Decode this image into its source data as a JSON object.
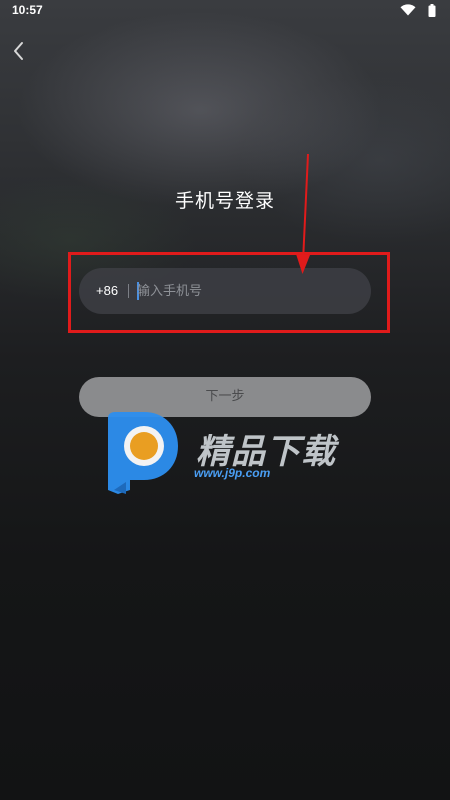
{
  "status_bar": {
    "time": "10:57",
    "icons": [
      "wifi-icon",
      "battery-icon"
    ]
  },
  "header": {
    "back_icon": "chevron-left-icon",
    "title": "手机号登录"
  },
  "phone_form": {
    "country_code": "+86",
    "phone_value": "",
    "phone_placeholder": "输入手机号"
  },
  "next_button": {
    "label": "下一步"
  },
  "watermark": {
    "logo_icon": "p-logo-icon",
    "text": "精品下载",
    "url": "www.j9p.com"
  },
  "colors": {
    "annotation": "#e01b1b",
    "caret": "#4a90e2",
    "button_bg": "#8a8b8d",
    "watermark_blue": "#2d8ff0",
    "watermark_orange": "#f5a623"
  }
}
